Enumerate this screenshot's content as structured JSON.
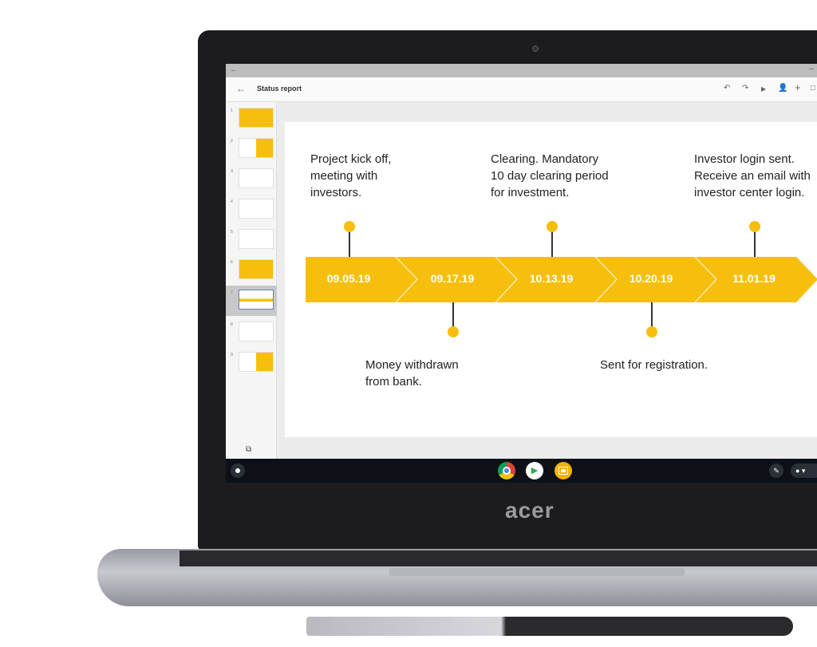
{
  "app": {
    "title": "Status report"
  },
  "toolbar": {
    "icons": [
      "undo-icon",
      "redo-icon",
      "present-icon",
      "share-icon",
      "add-icon",
      "more-icon"
    ]
  },
  "filmstrip": {
    "slide_numbers": [
      "1",
      "2",
      "3",
      "4",
      "5",
      "6",
      "7",
      "8",
      "9"
    ],
    "selected": "7"
  },
  "timeline": {
    "accent": "#f7bf0d",
    "dates": [
      "09.05.19",
      "09.17.19",
      "10.13.19",
      "10.20.19",
      "11.01.19"
    ],
    "events_top": [
      "Project kick off,\nmeeting with\ninvestors.",
      "Clearing. Mandatory\n10 day clearing period\nfor investment.",
      "Investor login sent.\nReceive an email with\ninvestor center login."
    ],
    "events_bottom": [
      "Money withdrawn\nfrom bank.",
      "Sent for registration."
    ]
  },
  "shelf": {
    "apps": [
      "chrome-icon",
      "play-store-icon",
      "slides-icon"
    ]
  },
  "device": {
    "brand": "acer"
  }
}
